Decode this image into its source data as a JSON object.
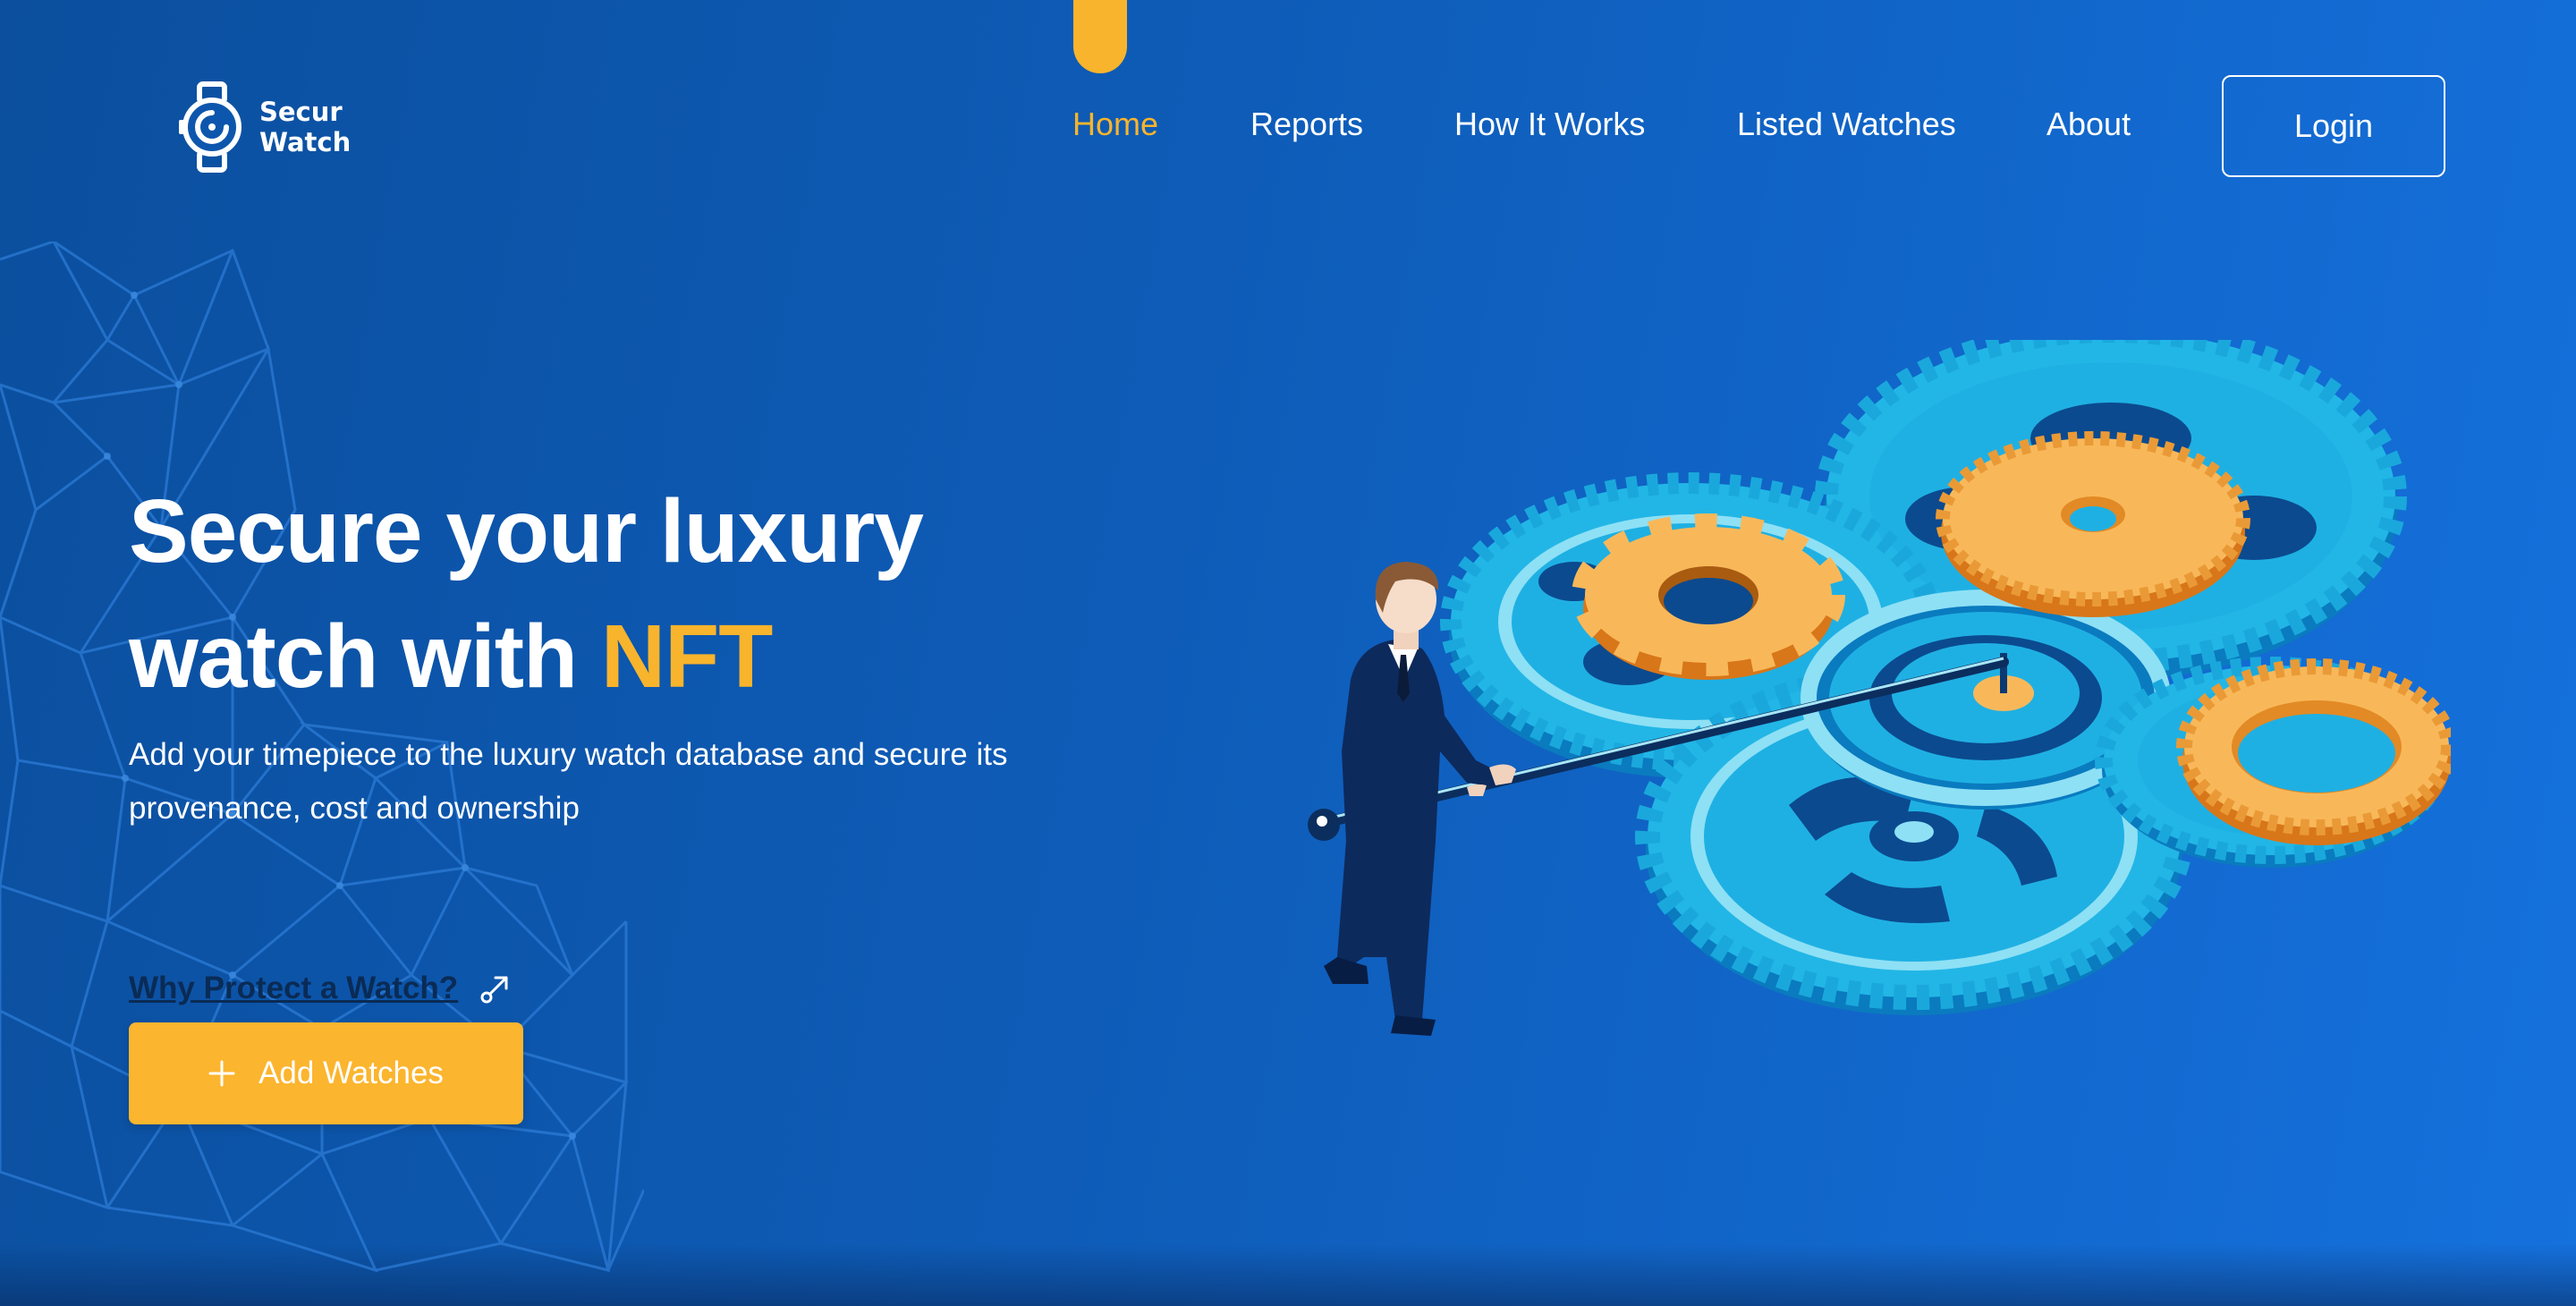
{
  "brand": {
    "line1": "Secur",
    "line2": "Watch",
    "icon": "watch-icon"
  },
  "nav": {
    "items": [
      {
        "label": "Home",
        "active": true
      },
      {
        "label": "Reports",
        "active": false
      },
      {
        "label": "How It Works",
        "active": false
      },
      {
        "label": "Listed Watches",
        "active": false
      },
      {
        "label": "About",
        "active": false
      }
    ],
    "login_label": "Login"
  },
  "hero": {
    "title_line1": "Secure your luxury",
    "title_line2_prefix": "watch with ",
    "title_accent": "NFT",
    "subtitle": "Add your timepiece to the luxury watch database and secure its provenance, cost and ownership",
    "why_link": "Why Protect a Watch?",
    "why_icon": "external-link-icon",
    "cta_label": "Add Watches",
    "cta_icon": "plus-icon"
  },
  "colors": {
    "accent": "#f8b42c",
    "background_start": "#0b4f9e",
    "background_end": "#1571dd",
    "gear_blue": "#1eb6e4",
    "gear_orange": "#f8b85a"
  }
}
